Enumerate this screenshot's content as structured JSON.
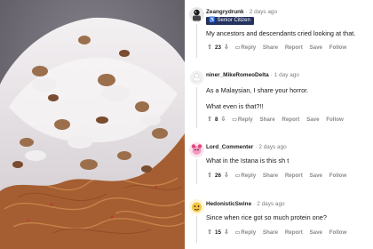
{
  "photo": {
    "alt_icon": "food-photo-rice-with-white-sauce"
  },
  "comments": [
    {
      "username": "Zeangrydrunk",
      "separator": "·",
      "time": "2 days ago",
      "flair": "Senior Citizen",
      "flair_icon": "person-cane-icon",
      "body": [
        "My ancestors and descendants cried looking at that."
      ],
      "score": "23",
      "actions": [
        "Reply",
        "Share",
        "Report",
        "Save",
        "Follow"
      ]
    },
    {
      "username": "niner_MikeRomeoDelta",
      "separator": "·",
      "time": "1 day ago",
      "body": [
        "As a Malaysian, I share your horror.",
        "What even is that?!!"
      ],
      "score": "8",
      "actions": [
        "Reply",
        "Share",
        "Report",
        "Save",
        "Follow"
      ]
    },
    {
      "username": "Lord_Commenter",
      "separator": "·",
      "time": "2 days ago",
      "body": [
        "What in the Istana is this sh t"
      ],
      "score": "26",
      "actions": [
        "Reply",
        "Share",
        "Report",
        "Save",
        "Follow"
      ]
    },
    {
      "username": "HedonisticSwine",
      "separator": "·",
      "time": "2 days ago",
      "body": [
        "Since when rice got so much protein one?"
      ],
      "score": "15",
      "actions": [
        "Reply",
        "Share",
        "Report",
        "Save",
        "Follow"
      ]
    }
  ],
  "colors": {
    "flair_bg": "#24325f",
    "meta_gray": "#878a8c"
  }
}
